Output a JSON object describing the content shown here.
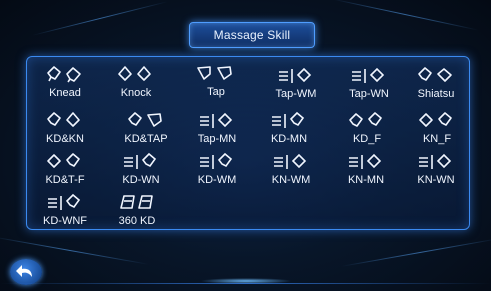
{
  "header": {
    "title": "Massage Skill"
  },
  "skills": [
    {
      "label": "Knead",
      "icon": "knead-hands-icon"
    },
    {
      "label": "Knock",
      "icon": "knock-hands-icon"
    },
    {
      "label": "Tap",
      "icon": "tap-hands-icon"
    },
    {
      "label": "Tap-WM",
      "icon": "tap-wm-icon"
    },
    {
      "label": "Tap-WN",
      "icon": "tap-wn-icon"
    },
    {
      "label": "Shiatsu",
      "icon": "shiatsu-hands-icon"
    },
    {
      "label": "KD&KN",
      "icon": "kd-kn-hands-icon"
    },
    {
      "label": "KD&TAP",
      "icon": "kd-tap-hands-icon"
    },
    {
      "label": "Tap-MN",
      "icon": "tap-mn-icon"
    },
    {
      "label": "KD-MN",
      "icon": "kd-mn-icon"
    },
    {
      "label": "KD_F",
      "icon": "kd-f-hands-icon"
    },
    {
      "label": "KN_F",
      "icon": "kn-f-hands-icon"
    },
    {
      "label": "KD&T-F",
      "icon": "kd-t-f-hands-icon"
    },
    {
      "label": "KD-WN",
      "icon": "kd-wn-icon"
    },
    {
      "label": "KD-WM",
      "icon": "kd-wm-icon"
    },
    {
      "label": "KN-WM",
      "icon": "kn-wm-icon"
    },
    {
      "label": "KN-MN",
      "icon": "kn-mn-icon"
    },
    {
      "label": "KN-WN",
      "icon": "kn-wn-icon"
    },
    {
      "label": "KD-WNF",
      "icon": "kd-wnf-icon"
    },
    {
      "label": "360 KD",
      "icon": "360-kd-hands-icon"
    }
  ],
  "footer": {
    "back_icon": "back-arrow-icon"
  },
  "colors": {
    "accent": "#3b8af0",
    "text": "#f1f6ff",
    "background": "#081629"
  }
}
